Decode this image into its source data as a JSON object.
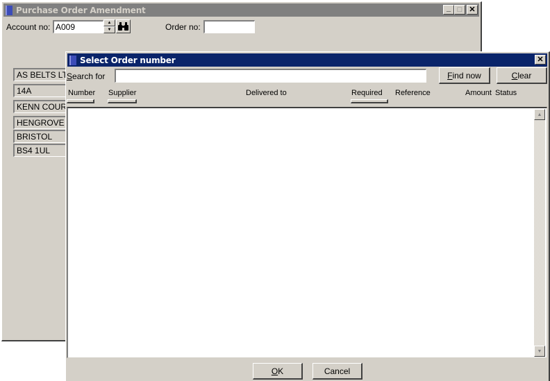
{
  "background_window": {
    "title": "Purchase Order Amendment",
    "title_buttons": {
      "minimize": "_",
      "maximize": "□",
      "close": "✕"
    },
    "account_label": "Account no:",
    "account_value": "A009",
    "order_label": "Order no:",
    "order_value": "",
    "address_lines": [
      "AS BELTS LTD",
      "14A",
      "KENN COURT",
      "HENGROVE",
      "BRISTOL",
      "BS4 1UL"
    ]
  },
  "dialog": {
    "title": "Select Order number",
    "close_glyph": "✕",
    "search_label_prefix": "S",
    "search_label_rest": "earch for",
    "search_value": "",
    "find_now_prefix": "F",
    "find_now_rest": "ind now",
    "clear_prefix": "C",
    "clear_rest": "lear",
    "columns": [
      "Number",
      "Supplier",
      "Delivered to",
      "Required",
      "Reference",
      "Amount",
      "Status"
    ],
    "rows": [],
    "ok_prefix": "O",
    "ok_rest": "K",
    "cancel_label": "Cancel",
    "scroll_up_glyph": "▲",
    "scroll_down_glyph": "▼"
  }
}
